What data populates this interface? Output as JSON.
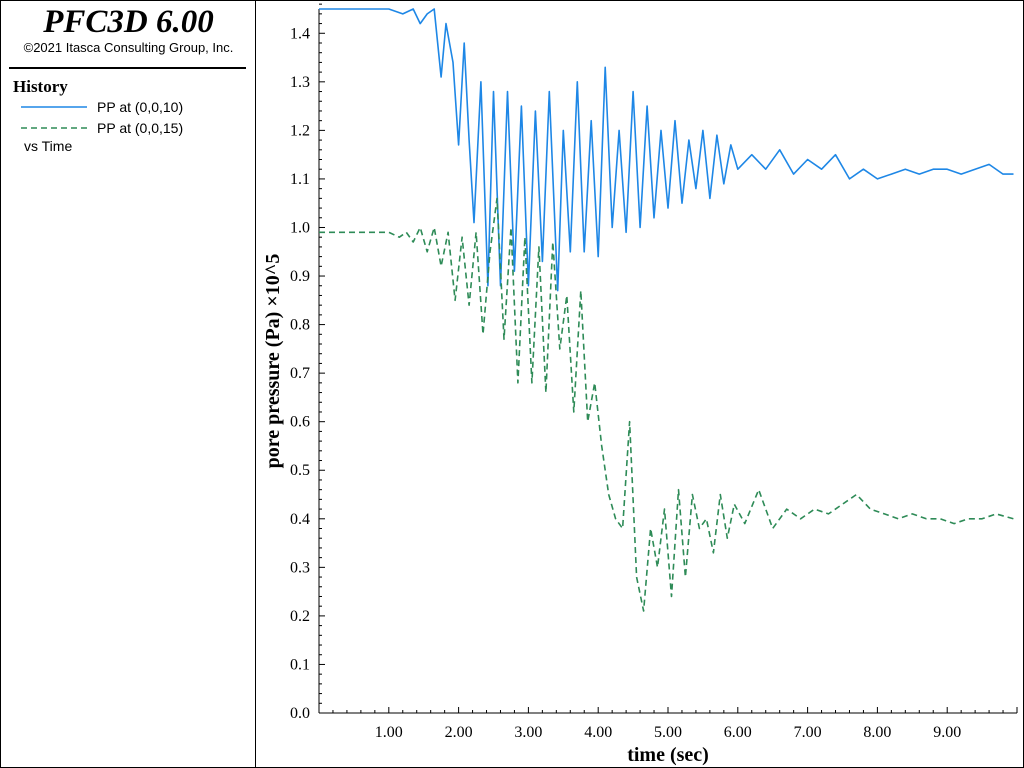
{
  "header": {
    "app_title": "PFC3D 6.00",
    "copyright": "©2021 Itasca Consulting Group, Inc."
  },
  "legend": {
    "heading": "History",
    "items": [
      {
        "label": "PP at (0,0,10)",
        "color": "#1e87e6",
        "style": "solid"
      },
      {
        "label": "PP at (0,0,15)",
        "color": "#2e8b57",
        "style": "dashed"
      }
    ],
    "vs_label": "vs Time"
  },
  "chart_data": {
    "type": "line",
    "xlabel": "time (sec)",
    "ylabel": "pore pressure (Pa) ×10^5",
    "xlim": [
      0,
      10
    ],
    "ylim": [
      0,
      1.45
    ],
    "x_ticks": [
      "1.00",
      "2.00",
      "3.00",
      "4.00",
      "5.00",
      "6.00",
      "7.00",
      "8.00",
      "9.00"
    ],
    "y_ticks": [
      "0.0",
      "0.1",
      "0.2",
      "0.3",
      "0.4",
      "0.5",
      "0.6",
      "0.7",
      "0.8",
      "0.9",
      "1.0",
      "1.1",
      "1.2",
      "1.3",
      "1.4"
    ],
    "series": [
      {
        "name": "PP at (0,0,10)",
        "color": "#1e87e6",
        "dashed": false,
        "x": [
          0,
          0.5,
          1.0,
          1.2,
          1.35,
          1.45,
          1.55,
          1.65,
          1.75,
          1.82,
          1.92,
          2.0,
          2.08,
          2.15,
          2.22,
          2.32,
          2.42,
          2.5,
          2.6,
          2.7,
          2.8,
          2.9,
          3.0,
          3.1,
          3.2,
          3.3,
          3.42,
          3.5,
          3.6,
          3.7,
          3.8,
          3.9,
          4.0,
          4.1,
          4.2,
          4.3,
          4.4,
          4.5,
          4.6,
          4.7,
          4.8,
          4.9,
          5.0,
          5.1,
          5.2,
          5.3,
          5.4,
          5.5,
          5.6,
          5.7,
          5.8,
          5.9,
          6.0,
          6.2,
          6.4,
          6.6,
          6.8,
          7.0,
          7.2,
          7.4,
          7.6,
          7.8,
          8.0,
          8.2,
          8.4,
          8.6,
          8.8,
          9.0,
          9.2,
          9.4,
          9.6,
          9.8,
          9.95
        ],
        "y": [
          1.45,
          1.45,
          1.45,
          1.44,
          1.45,
          1.42,
          1.44,
          1.45,
          1.31,
          1.42,
          1.34,
          1.17,
          1.38,
          1.18,
          1.01,
          1.3,
          0.88,
          1.28,
          0.88,
          1.28,
          0.91,
          1.25,
          0.88,
          1.24,
          0.93,
          1.28,
          0.87,
          1.2,
          0.95,
          1.3,
          0.95,
          1.22,
          0.94,
          1.33,
          1.0,
          1.2,
          0.99,
          1.28,
          1.0,
          1.25,
          1.02,
          1.2,
          1.04,
          1.22,
          1.05,
          1.18,
          1.08,
          1.2,
          1.06,
          1.19,
          1.09,
          1.17,
          1.12,
          1.15,
          1.12,
          1.16,
          1.11,
          1.14,
          1.12,
          1.15,
          1.1,
          1.12,
          1.1,
          1.11,
          1.12,
          1.11,
          1.12,
          1.12,
          1.11,
          1.12,
          1.13,
          1.11,
          1.11
        ]
      },
      {
        "name": "PP at (0,0,15)",
        "color": "#2e8b57",
        "dashed": true,
        "x": [
          0,
          0.5,
          1.0,
          1.15,
          1.25,
          1.35,
          1.45,
          1.55,
          1.65,
          1.75,
          1.85,
          1.95,
          2.05,
          2.15,
          2.25,
          2.35,
          2.45,
          2.55,
          2.65,
          2.75,
          2.85,
          2.95,
          3.05,
          3.15,
          3.25,
          3.35,
          3.45,
          3.55,
          3.65,
          3.75,
          3.85,
          3.95,
          4.05,
          4.15,
          4.25,
          4.35,
          4.45,
          4.55,
          4.65,
          4.75,
          4.85,
          4.95,
          5.05,
          5.15,
          5.25,
          5.35,
          5.45,
          5.55,
          5.65,
          5.75,
          5.85,
          5.95,
          6.1,
          6.3,
          6.5,
          6.7,
          6.9,
          7.1,
          7.3,
          7.5,
          7.7,
          7.9,
          8.1,
          8.3,
          8.5,
          8.7,
          8.9,
          9.1,
          9.3,
          9.5,
          9.7,
          9.95
        ],
        "y": [
          0.99,
          0.99,
          0.99,
          0.98,
          0.99,
          0.97,
          1.0,
          0.95,
          1.0,
          0.92,
          0.99,
          0.85,
          0.98,
          0.84,
          0.99,
          0.78,
          0.95,
          1.06,
          0.77,
          1.0,
          0.68,
          0.98,
          0.68,
          0.96,
          0.66,
          0.97,
          0.75,
          0.86,
          0.62,
          0.87,
          0.6,
          0.68,
          0.55,
          0.45,
          0.4,
          0.38,
          0.6,
          0.28,
          0.21,
          0.38,
          0.3,
          0.42,
          0.24,
          0.46,
          0.28,
          0.45,
          0.38,
          0.4,
          0.33,
          0.45,
          0.36,
          0.43,
          0.39,
          0.46,
          0.38,
          0.42,
          0.4,
          0.42,
          0.41,
          0.43,
          0.45,
          0.42,
          0.41,
          0.4,
          0.41,
          0.4,
          0.4,
          0.39,
          0.4,
          0.4,
          0.41,
          0.4
        ]
      }
    ]
  }
}
